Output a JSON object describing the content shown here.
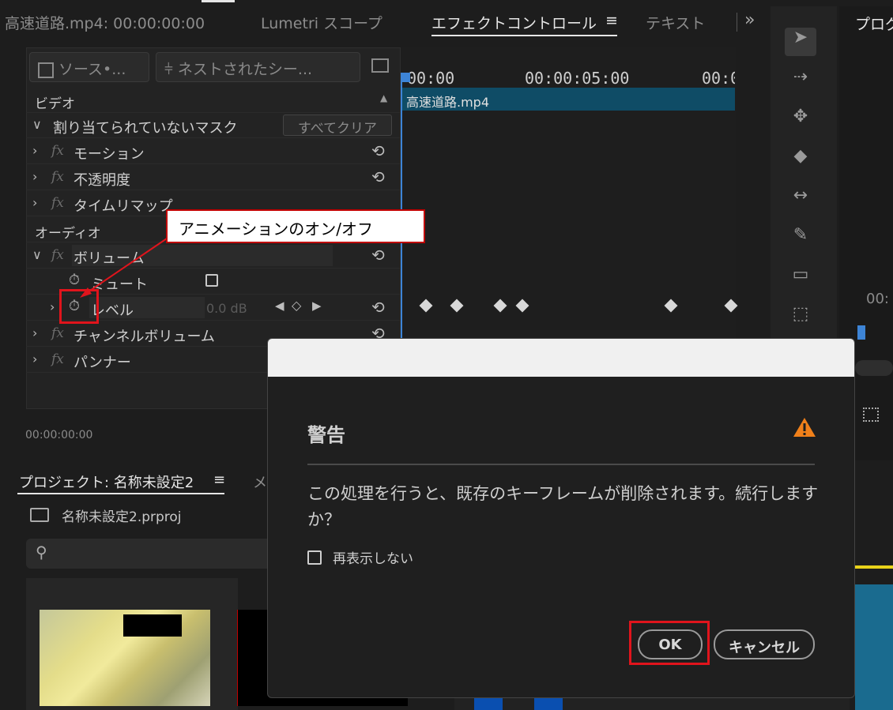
{
  "tabs": {
    "source_clip": "高速道路.mp4: 00:00:00:00",
    "lumetri": "Lumetri スコープ",
    "effect_controls": "エフェクトコントロール",
    "effect_controls_menu": "≡",
    "text": "テキスト",
    "more": "»",
    "program": "プログ"
  },
  "effect_controls": {
    "source_button": "ソース•...",
    "nest_button": "ネストされたシー...",
    "video_header": "ビデオ",
    "mask_row": "割り当てられていないマスク",
    "clear_all_button": "すべてクリア",
    "motion": "モーション",
    "opacity": "不透明度",
    "time_remap": "タイムリマップ",
    "audio_header": "オーディオ",
    "volume": "ボリューム",
    "mute": "ミュート",
    "level": "レベル",
    "level_value": "0.0 dB",
    "channel_volume": "チャンネルボリューム",
    "panner": "パンナー",
    "timecode": "00:00:00:00"
  },
  "timeline": {
    "ruler_labels": [
      "00:00",
      "00:00:05:00",
      "00:0"
    ],
    "clip_name": "高速道路.mp4"
  },
  "program": {
    "timecode_partial": "00:"
  },
  "annotation": {
    "callout_text": "アニメーションのオン/オフ"
  },
  "project": {
    "tab_title": "プロジェクト: 名称未設定2",
    "tab_menu": "≡",
    "next_tab_partial": "メ",
    "file_name": "名称未設定2.prproj"
  },
  "dialog": {
    "title": "警告",
    "message": "この処理を行うと、既存のキーフレームが削除されます。続行しますか？",
    "checkbox_label": "再表示しない",
    "ok_label": "OK",
    "cancel_label": "キャンセル"
  },
  "colors": {
    "accent_blue": "#3d84d6",
    "clip_bar": "#0f4c66",
    "warning_orange": "#f0801a",
    "highlight_red": "#e0141c"
  }
}
